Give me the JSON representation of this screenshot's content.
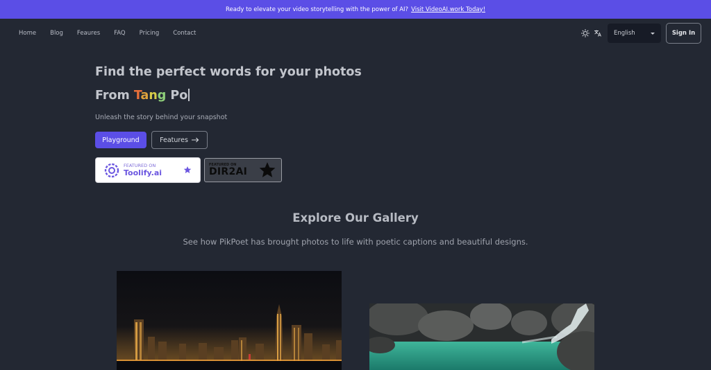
{
  "banner": {
    "text": "Ready to elevate your video storytelling with the power of AI?",
    "link": "Visit VideoAI.work Today!"
  },
  "nav": {
    "links": [
      "Home",
      "Blog",
      "Feaures",
      "FAQ",
      "Pricing",
      "Contact"
    ],
    "language": "English",
    "sign_in": "Sign In"
  },
  "hero": {
    "title": "Find the perfect words for your photos",
    "typed_prefix": "From ",
    "typed_word": [
      "T",
      "a",
      "n",
      "g",
      " Po"
    ],
    "subtitle": "Unleash the story behind your snapshot",
    "primary_button": "Playground",
    "secondary_button": "Features"
  },
  "badges": {
    "toolify": {
      "small": "FEATURED ON",
      "name": "Toolify.ai"
    },
    "dir2ai": {
      "small": "FEATURED ON",
      "name": "DIR2AI"
    }
  },
  "gallery": {
    "title": "Explore Our Gallery",
    "subtitle": "See how PikPoet has brought photos to life with poetic captions and beautiful designs."
  },
  "colors": {
    "accent": "#5b4ee6",
    "background": "#232833"
  }
}
